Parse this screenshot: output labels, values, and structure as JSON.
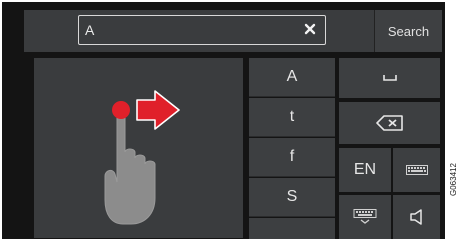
{
  "search": {
    "input_value": "A",
    "button_label": "Search"
  },
  "suggestions": [
    "A",
    "t",
    "f",
    "S"
  ],
  "keyboard": {
    "language_label": "EN"
  },
  "figure_code": "G063412",
  "colors": {
    "screen_bg": "#141414",
    "panel_bg": "#3a3c3e",
    "accent_red": "#e0202a",
    "hand_gray": "#8a8a8a"
  }
}
